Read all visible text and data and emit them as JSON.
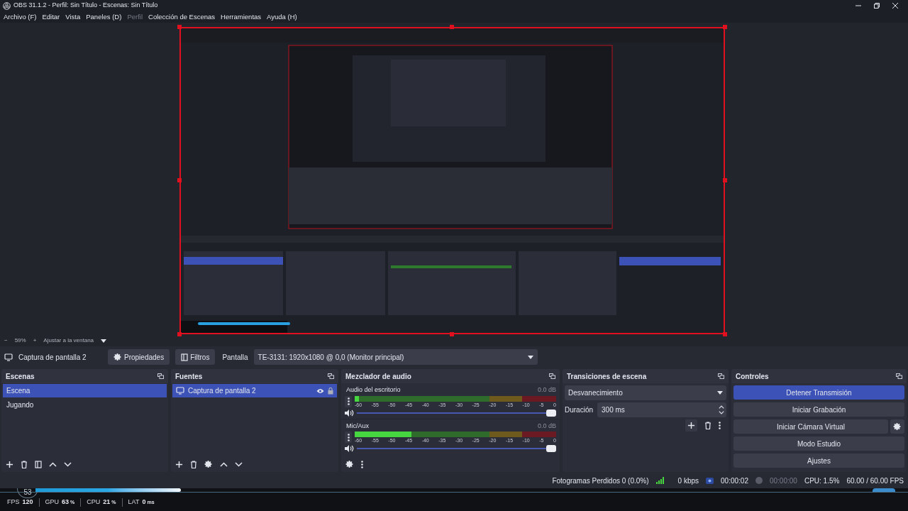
{
  "window": {
    "title": "OBS 31.1.2 - Perfil: Sin Título - Escenas: Sin Título"
  },
  "menu": [
    {
      "label": "Archivo (F)",
      "disabled": false
    },
    {
      "label": "Editar",
      "disabled": false
    },
    {
      "label": "Vista",
      "disabled": false
    },
    {
      "label": "Paneles (D)",
      "disabled": false
    },
    {
      "label": "Perfil",
      "disabled": true
    },
    {
      "label": "Colección de Escenas",
      "disabled": false
    },
    {
      "label": "Herramientas",
      "disabled": false
    },
    {
      "label": "Ayuda (H)",
      "disabled": false
    }
  ],
  "preview": {
    "kind": "picture",
    "selected": true
  },
  "zoom_bar": {
    "zoom_out": "−",
    "zoom": "59%",
    "zoom_in": "+",
    "fit": "Ajustar a la ventana"
  },
  "source_bar": {
    "source": "Captura de pantalla 2",
    "properties": "Propiedades",
    "filters": "Filtros",
    "field_label": "Pantalla",
    "field_value": "TE-3131: 1920x1080 @ 0,0 (Monitor principal)"
  },
  "scenes": {
    "title": "Escenas",
    "items": [
      {
        "label": "Escena",
        "selected": true
      },
      {
        "label": "Jugando",
        "selected": false
      }
    ]
  },
  "sources": {
    "title": "Fuentes",
    "items": [
      {
        "label": "Captura de pantalla 2",
        "selected": true,
        "visible": true,
        "locked": true
      }
    ]
  },
  "mixer": {
    "title": "Mezclador de audio",
    "channels": [
      {
        "name": "Audio del escritorio",
        "reading": "0.0 dB",
        "meter": {
          "level": 0.02
        },
        "fader": {
          "level": 1
        },
        "scale": [
          "-60",
          "-55",
          "-50",
          "-45",
          "-40",
          "-35",
          "-30",
          "-25",
          "-20",
          "-15",
          "-10",
          "-5",
          "0"
        ]
      },
      {
        "name": "Mic/Aux",
        "reading": "0.0 dB",
        "meter": {
          "level": 0.28
        },
        "fader": {
          "level": 1
        },
        "scale": [
          "-60",
          "-55",
          "-50",
          "-45",
          "-40",
          "-35",
          "-30",
          "-25",
          "-20",
          "-15",
          "-10",
          "-5",
          "0"
        ]
      }
    ]
  },
  "transitions": {
    "title": "Transiciones de escena",
    "transition": "Desvanecimiento",
    "duration_label": "Duración",
    "duration": "300 ms"
  },
  "controls": {
    "title": "Controles",
    "buttons": [
      {
        "label": "Detener Transmisión",
        "selected": true,
        "settings": false
      },
      {
        "label": "Iniciar Grabación",
        "selected": false,
        "settings": false
      },
      {
        "label": "Iniciar Cámara Virtual",
        "selected": false,
        "settings": true
      },
      {
        "label": "Modo Estudio",
        "selected": false,
        "settings": false
      },
      {
        "label": "Ajustes",
        "selected": false,
        "settings": false
      }
    ]
  },
  "status_bar": {
    "dropped": "Fotogramas Perdidos 0 (0.0%)",
    "kbps": "0 kbps",
    "stream_time": "00:00:02",
    "record_time": "00:00:00",
    "cpu": "CPU: 1.5%",
    "fps": "60.00 / 60.00 FPS"
  },
  "overlay": {
    "badge": "53",
    "stats": [
      {
        "label": "FPS",
        "value": "120"
      },
      {
        "label": "GPU",
        "value": "63",
        "unit": "%"
      },
      {
        "label": "CPU",
        "value": "21",
        "unit": "%"
      },
      {
        "label": "LAT",
        "value": "0",
        "unit": "ms"
      }
    ]
  }
}
